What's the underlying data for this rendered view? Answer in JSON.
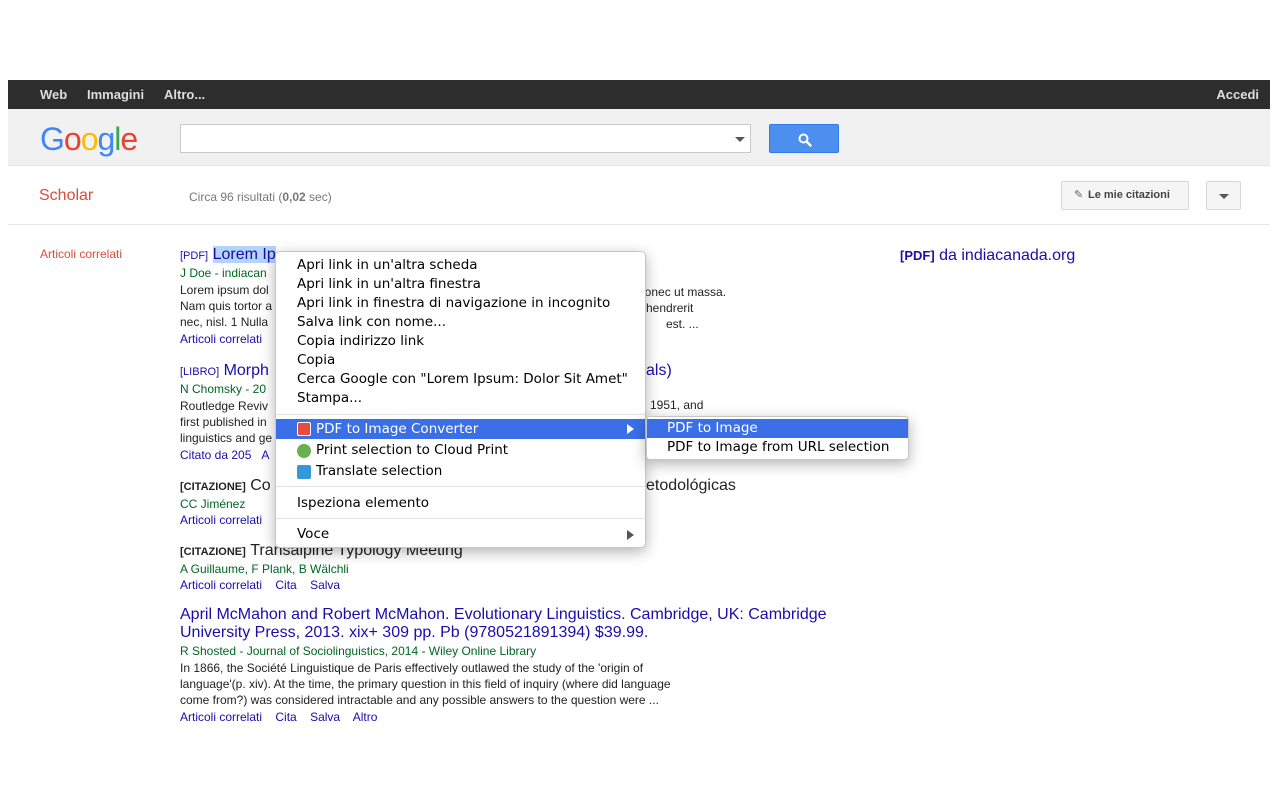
{
  "topbar": {
    "links": [
      "Web",
      "Immagini",
      "Altro..."
    ],
    "signin": "Accedi"
  },
  "header": {
    "logo_letters": [
      {
        "char": "G",
        "color": "#4285f4"
      },
      {
        "char": "o",
        "color": "#ea4335"
      },
      {
        "char": "o",
        "color": "#fbbc05"
      },
      {
        "char": "g",
        "color": "#4285f4"
      },
      {
        "char": "l",
        "color": "#34a853"
      },
      {
        "char": "e",
        "color": "#ea4335"
      }
    ],
    "search_value": "",
    "search_icon": "magnifier-icon"
  },
  "scholar": {
    "label": "Scholar",
    "stats_prefix": "Circa 96 risultati (",
    "stats_time": "0,02",
    "stats_suffix": " sec)",
    "my_citations": "Le mie citazioni"
  },
  "sidebar": {
    "related": "Articoli correlati"
  },
  "results": [
    {
      "tag": "[PDF]",
      "title_selected": "Lorem Ipsum: Dolor Sit Amet",
      "title_visible": "Lorem Ip",
      "authors": "J Doe - indiacan",
      "snippet_lines": [
        "Lorem ipsum dol",
        "Nam quis tortor a",
        "nec, nisl. 1 Nulla"
      ],
      "snippet_right": [
        "Donec ut massa.",
        "hendrerit",
        "est. ..."
      ],
      "links": [
        "Articoli correlati"
      ]
    },
    {
      "tag": "[LIBRO]",
      "title": "Morph",
      "title_right": "als)",
      "authors": "N Chomsky - 20",
      "snippet_lines": [
        "Routledge Reviv",
        "first published in",
        "linguistics and ge"
      ],
      "snippet_right": [
        "1951, and",
        "",
        ""
      ],
      "links": [
        "Citato da 205",
        "A"
      ]
    },
    {
      "tag": "[CITAZIONE]",
      "title": "Co",
      "title_right": "etodológicas",
      "authors": "CC Jiménez",
      "links": [
        "Articoli correlati"
      ]
    },
    {
      "tag": "[CITAZIONE]",
      "title": "Transalpine Typology Meeting",
      "authors": "A Guillaume, F Plank, B Wälchli",
      "links": [
        "Articoli correlati",
        "Cita",
        "Salva"
      ]
    },
    {
      "title_line1": "April McMahon and Robert McMahon. Evolutionary Linguistics. Cambridge, UK: Cambridge",
      "title_line2": "University Press, 2013. xix+ 309 pp. Pb (9780521891394) $39.99.",
      "authors": "R Shosted - Journal of Sociolinguistics, 2014 - Wiley Online Library",
      "snippet_lines": [
        "In 1866, the Société Linguistique de Paris effectively outlawed the study of the 'origin of",
        "language'(p. xiv). At the time, the primary question in this field of inquiry (where did language",
        "come from?) was considered intractable and any possible answers to the question were ..."
      ],
      "links": [
        "Articoli correlati",
        "Cita",
        "Salva",
        "Altro"
      ]
    }
  ],
  "side_pdf": {
    "tag": "[PDF]",
    "text": "da indiacanada.org"
  },
  "context_menu": {
    "items": [
      "Apri link in un'altra scheda",
      "Apri link in un'altra finestra",
      "Apri link in finestra di navigazione in incognito",
      "Salva link con nome...",
      "Copia indirizzo link",
      "Copia",
      "Cerca Google con \"Lorem Ipsum: Dolor Sit Amet\"",
      "Stampa..."
    ],
    "ext_items": [
      {
        "label": "PDF to Image Converter",
        "icon": "pdf-converter-icon",
        "color": "#c0392b"
      },
      {
        "label": "Print selection to Cloud Print",
        "icon": "cloud-print-icon",
        "color": "#6ab04c"
      },
      {
        "label": "Translate selection",
        "icon": "translate-icon",
        "color": "#3498db"
      }
    ],
    "inspect": "Ispeziona elemento",
    "voice": "Voce"
  },
  "submenu": {
    "items": [
      "PDF to Image",
      "PDF to Image from URL selection"
    ]
  }
}
